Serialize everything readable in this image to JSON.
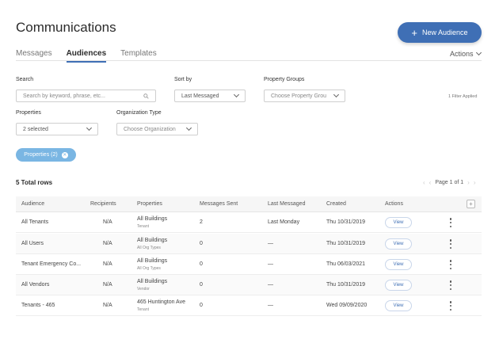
{
  "header": {
    "title": "Communications",
    "new_button": "New Audience",
    "actions_label": "Actions"
  },
  "tabs": [
    {
      "label": "Messages",
      "active": false
    },
    {
      "label": "Audiences",
      "active": true
    },
    {
      "label": "Templates",
      "active": false
    }
  ],
  "filters": {
    "search_label": "Search",
    "search_placeholder": "Search by keyword, phrase, etc...",
    "sort_label": "Sort by",
    "sort_value": "Last Messaged",
    "property_groups_label": "Property Groups",
    "property_groups_value": "Choose Property Groups",
    "filter_applied": "1 Filter Applied",
    "properties_label": "Properties",
    "properties_value": "2 selected",
    "org_type_label": "Organization Type",
    "org_type_value": "Choose Organization",
    "chip_label": "Properties (2)"
  },
  "table": {
    "total_rows": "5 Total rows",
    "page_label": "Page 1 of 1",
    "columns": [
      "Audience",
      "Recipients",
      "Properties",
      "Messages Sent",
      "Last Messaged",
      "Created",
      "Actions"
    ],
    "view_label": "View",
    "rows": [
      {
        "audience": "All Tenants",
        "recipients": "N/A",
        "property": "All Buildings",
        "property_sub": "Tenant",
        "messages_sent": "2",
        "last_messaged": "Last Monday",
        "created": "Thu 10/31/2019"
      },
      {
        "audience": "All Users",
        "recipients": "N/A",
        "property": "All Buildings",
        "property_sub": "All Org Types",
        "messages_sent": "0",
        "last_messaged": "—",
        "created": "Thu 10/31/2019"
      },
      {
        "audience": "Tenant Emergency Co...",
        "recipients": "N/A",
        "property": "All Buildings",
        "property_sub": "All Org Types",
        "messages_sent": "0",
        "last_messaged": "—",
        "created": "Thu 06/03/2021"
      },
      {
        "audience": "All Vendors",
        "recipients": "N/A",
        "property": "All Buildings",
        "property_sub": "Vendor",
        "messages_sent": "0",
        "last_messaged": "—",
        "created": "Thu 10/31/2019"
      },
      {
        "audience": "Tenants - 465",
        "recipients": "N/A",
        "property": "465 Huntington Ave",
        "property_sub": "Tenant",
        "messages_sent": "0",
        "last_messaged": "—",
        "created": "Wed 09/09/2020"
      }
    ]
  },
  "colors": {
    "accent": "#3f6fb5",
    "chip": "#7ab6e3"
  }
}
